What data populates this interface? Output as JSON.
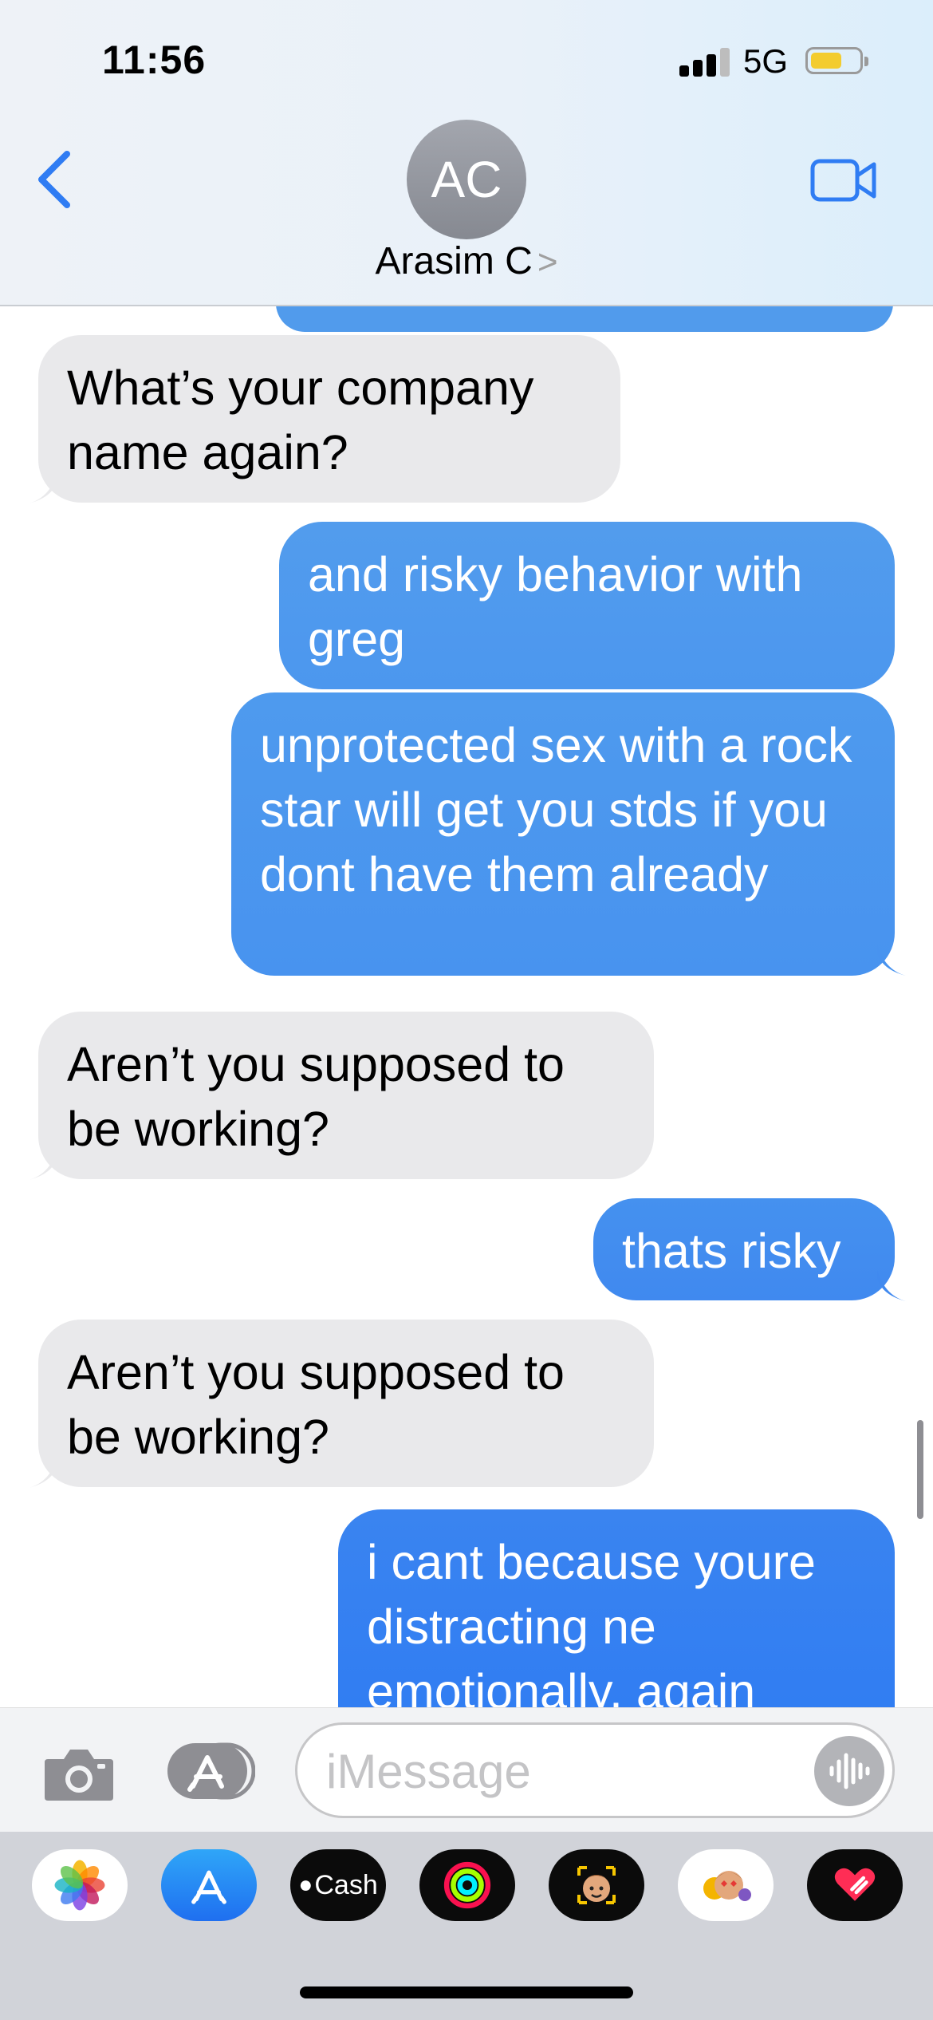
{
  "status_bar": {
    "time": "11:56",
    "network": "5G",
    "battery_level": 0.65
  },
  "header": {
    "avatar_initials": "AC",
    "contact_name": "Arasim C",
    "contact_chevron": ">"
  },
  "messages": [
    {
      "from": "them",
      "text": "What’s your company name again?"
    },
    {
      "from": "me",
      "text": "and risky behavior with greg"
    },
    {
      "from": "me",
      "text": "unprotected sex with a rock star will get you stds if you dont have them already"
    },
    {
      "from": "them",
      "text": "Aren’t you supposed to be working?"
    },
    {
      "from": "me",
      "text": "thats risky"
    },
    {
      "from": "them",
      "text": "Aren’t you supposed to be working?"
    },
    {
      "from": "me",
      "text": "i cant because youre distracting ne emotionally. again"
    }
  ],
  "input": {
    "placeholder": "iMessage",
    "value": ""
  },
  "app_drawer": {
    "cash_label": "Cash",
    "apps": [
      "photos-app",
      "app-store-app",
      "apple-cash-app",
      "fitness-app",
      "memoji-app",
      "memoji-stickers-app",
      "digital-touch-app"
    ]
  },
  "colors": {
    "sent_top": "#519bec",
    "sent_bottom": "#2f7cf3",
    "received": "#e9e9eb",
    "accent": "#2f7cf3"
  }
}
